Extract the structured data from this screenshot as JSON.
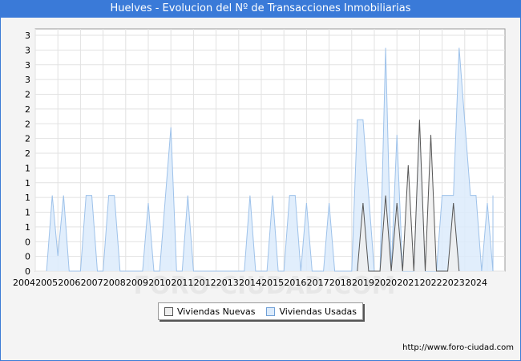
{
  "title": "Huelves - Evolucion del Nº de Transacciones Inmobiliarias",
  "footer_url": "http://www.foro-ciudad.com",
  "watermark": "FORO-CIUDAD.COM",
  "colors": {
    "header": "#3a7ad8",
    "nuevas_fill": "#eeeeee",
    "nuevas_line": "#555555",
    "usadas_fill": "#dcebfb",
    "usadas_line": "#9ec2ea"
  },
  "chart_data": {
    "type": "area",
    "xlabel": "",
    "ylabel": "",
    "y_tick_labels": [
      "0",
      "0",
      "0",
      "1",
      "1",
      "1",
      "1",
      "1",
      "2",
      "2",
      "2",
      "2",
      "2",
      "3",
      "3",
      "3",
      "3"
    ],
    "x_tick_labels": [
      "2004",
      "2005",
      "2006",
      "2007",
      "2008",
      "2009",
      "2010",
      "2011",
      "2012",
      "2013",
      "2014",
      "2015",
      "2016",
      "2017",
      "2018",
      "2019",
      "2020",
      "2021",
      "2022",
      "2023",
      "2024"
    ],
    "ylim": [
      0,
      3.2
    ],
    "xlim": [
      2004.5,
      2024.75
    ],
    "grid": true,
    "legend_position": "bottom-center",
    "series": [
      {
        "name": "Viviendas Nuevas",
        "points": [
          [
            2018.75,
            0
          ],
          [
            2019.0,
            0.9
          ],
          [
            2019.25,
            0
          ],
          [
            2019.75,
            0
          ],
          [
            2020.0,
            1.0
          ],
          [
            2020.25,
            0
          ],
          [
            2020.25,
            0
          ],
          [
            2020.5,
            0.9
          ],
          [
            2020.75,
            0
          ],
          [
            2020.75,
            0
          ],
          [
            2021.0,
            1.4
          ],
          [
            2021.25,
            0
          ],
          [
            2021.25,
            0
          ],
          [
            2021.5,
            2.0
          ],
          [
            2021.75,
            0
          ],
          [
            2021.75,
            0
          ],
          [
            2022.0,
            1.8
          ],
          [
            2022.25,
            0
          ],
          [
            2022.75,
            0
          ],
          [
            2023.0,
            0.9
          ],
          [
            2023.25,
            0
          ]
        ]
      },
      {
        "name": "Viviendas Usadas",
        "points": [
          [
            2005.0,
            0
          ],
          [
            2005.25,
            1.0
          ],
          [
            2005.5,
            0.2
          ],
          [
            2005.75,
            1.0
          ],
          [
            2006.0,
            0
          ],
          [
            2006.5,
            0
          ],
          [
            2006.75,
            1.0
          ],
          [
            2007.0,
            1.0
          ],
          [
            2007.25,
            0
          ],
          [
            2007.5,
            0
          ],
          [
            2007.75,
            1.0
          ],
          [
            2008.0,
            1.0
          ],
          [
            2008.25,
            0
          ],
          [
            2009.25,
            0
          ],
          [
            2009.5,
            0.9
          ],
          [
            2009.75,
            0
          ],
          [
            2010.0,
            0
          ],
          [
            2010.5,
            1.9
          ],
          [
            2010.75,
            0
          ],
          [
            2011.0,
            0
          ],
          [
            2011.25,
            1.0
          ],
          [
            2011.5,
            0
          ],
          [
            2013.75,
            0
          ],
          [
            2014.0,
            1.0
          ],
          [
            2014.25,
            0
          ],
          [
            2014.75,
            0
          ],
          [
            2015.0,
            1.0
          ],
          [
            2015.25,
            0
          ],
          [
            2015.5,
            0
          ],
          [
            2015.75,
            1.0
          ],
          [
            2016.0,
            1.0
          ],
          [
            2016.25,
            0
          ],
          [
            2016.25,
            0
          ],
          [
            2016.5,
            0.9
          ],
          [
            2016.75,
            0
          ],
          [
            2017.25,
            0
          ],
          [
            2017.5,
            0.9
          ],
          [
            2017.75,
            0
          ],
          [
            2018.5,
            0
          ],
          [
            2018.75,
            2.0
          ],
          [
            2019.0,
            2.0
          ],
          [
            2019.5,
            0
          ],
          [
            2019.75,
            0
          ],
          [
            2020.0,
            2.95
          ],
          [
            2020.25,
            0
          ],
          [
            2020.25,
            0
          ],
          [
            2020.5,
            1.8
          ],
          [
            2020.75,
            0
          ],
          [
            2021.25,
            0
          ],
          [
            2021.5,
            1.8
          ],
          [
            2021.75,
            0
          ],
          [
            2022.25,
            0
          ],
          [
            2022.5,
            1.0
          ],
          [
            2023.0,
            1.0
          ],
          [
            2023.25,
            2.95
          ],
          [
            2023.75,
            1.0
          ],
          [
            2024.0,
            1.0
          ],
          [
            2024.25,
            0
          ],
          [
            2024.25,
            0
          ],
          [
            2024.5,
            0.9
          ],
          [
            2024.75,
            0
          ],
          [
            2024.75,
            1.0
          ]
        ]
      }
    ]
  },
  "legend": {
    "items": [
      {
        "label": "Viviendas Nuevas"
      },
      {
        "label": "Viviendas Usadas"
      }
    ]
  }
}
